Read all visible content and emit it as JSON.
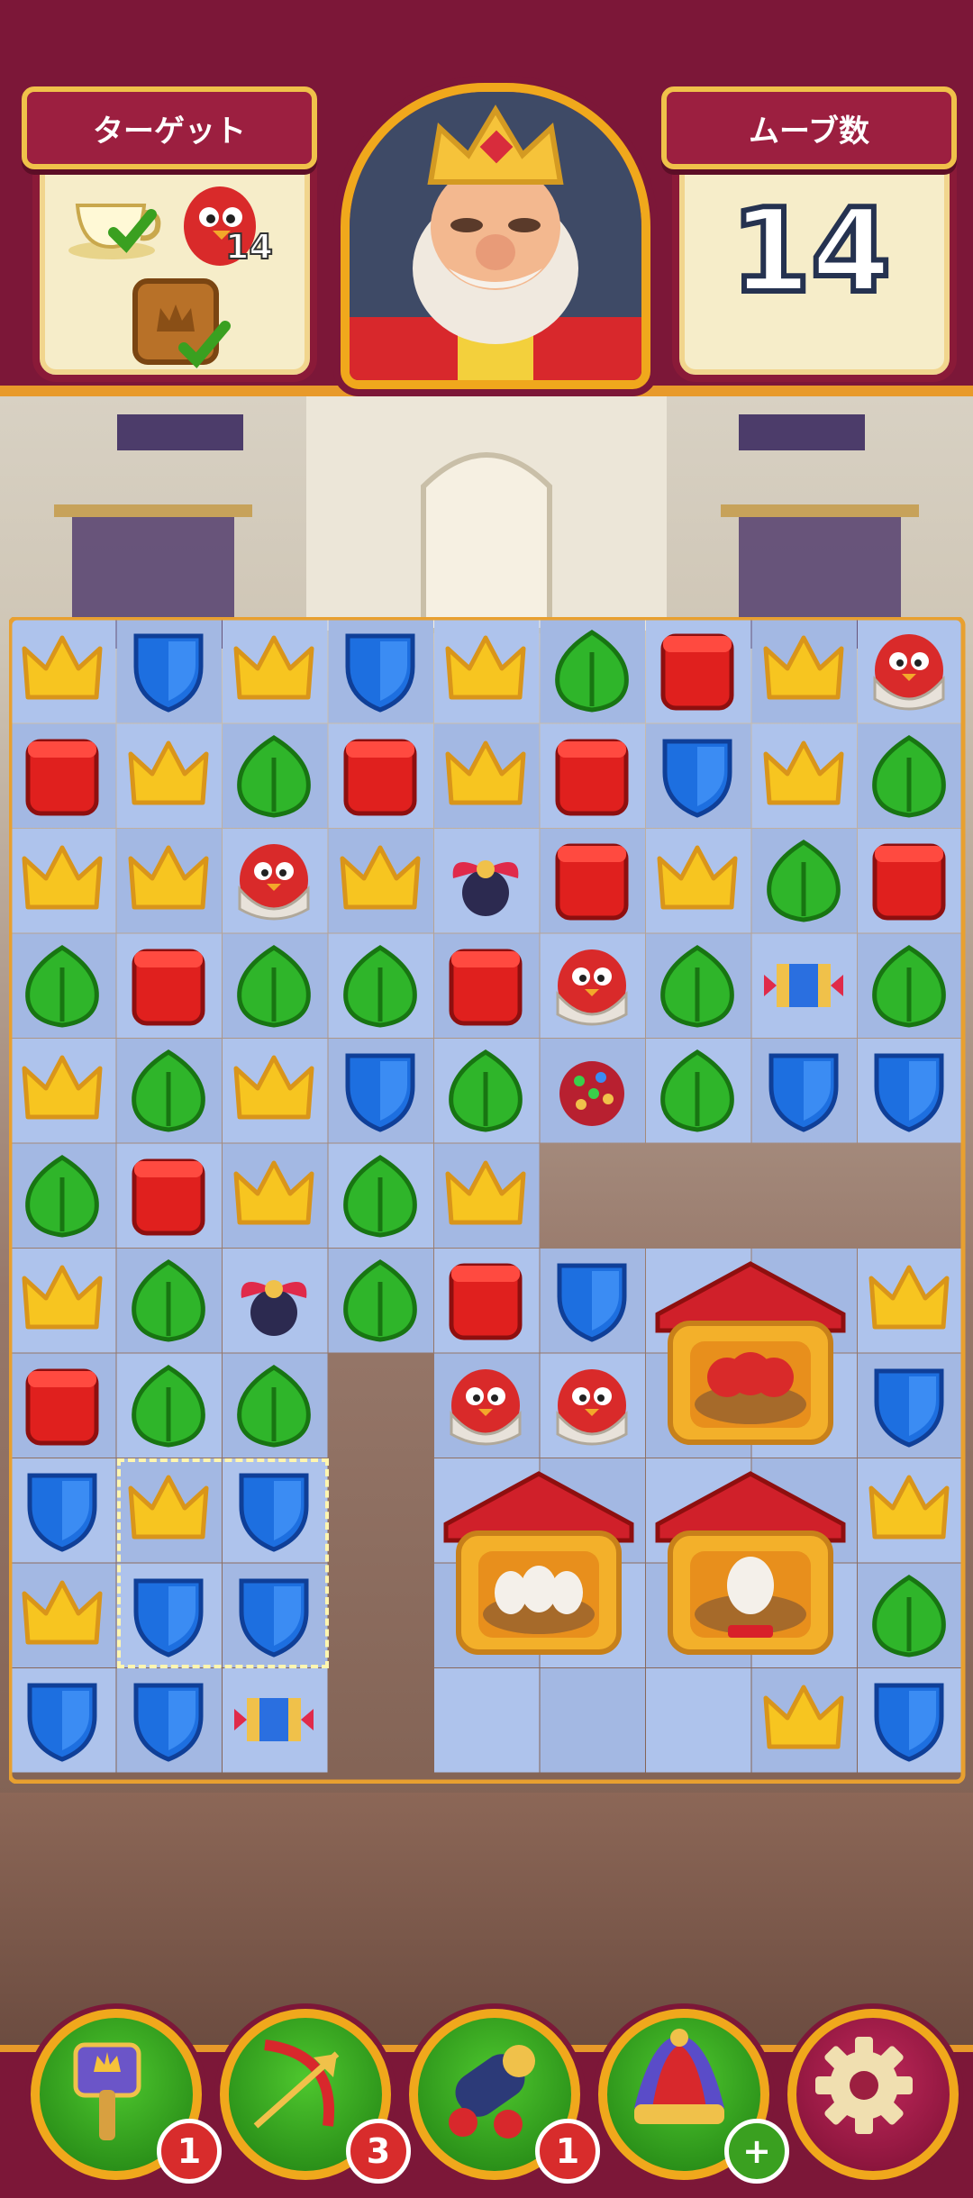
{
  "header": {
    "target_label": "ターゲット",
    "moves_label": "ムーブ数",
    "moves_left": "14",
    "targets": [
      {
        "icon": "teacup-icon",
        "done": true
      },
      {
        "icon": "red-bird-icon",
        "count": "14"
      },
      {
        "icon": "crown-box-icon",
        "done": true
      }
    ]
  },
  "board": {
    "cols": 9,
    "rows": 11,
    "grid": [
      [
        "crown",
        "shield",
        "crown",
        "shield",
        "crown",
        "leaf",
        "box",
        "crown",
        "bird"
      ],
      [
        "box",
        "crown",
        "leaf",
        "box",
        "crown",
        "box",
        "shield",
        "crown",
        "leaf"
      ],
      [
        "crown",
        "crown",
        "bird",
        "crown",
        "propeller",
        "box",
        "crown",
        "leaf",
        "box"
      ],
      [
        "leaf",
        "box",
        "leaf",
        "leaf",
        "box",
        "bird",
        "leaf",
        "rocket",
        "leaf"
      ],
      [
        "crown",
        "leaf",
        "crown",
        "shield",
        "leaf",
        "bomb",
        "leaf",
        "shield",
        "shield"
      ],
      [
        "leaf",
        "box",
        "crown",
        "leaf",
        "crown",
        "hole",
        "hole",
        "hole",
        "hole"
      ],
      [
        "crown",
        "leaf",
        "propeller",
        "leaf",
        "box",
        "shield",
        "nest",
        "",
        "crown"
      ],
      [
        "box",
        "leaf",
        "leaf",
        "hole",
        "bird",
        "bird",
        "",
        "",
        "shield"
      ],
      [
        "shield",
        "crown",
        "shield",
        "hole",
        "nest",
        "",
        "nest",
        "",
        "crown"
      ],
      [
        "crown",
        "shield",
        "shield",
        "hole",
        "",
        "",
        "",
        "",
        "leaf"
      ],
      [
        "shield",
        "shield",
        "rocket",
        "hole",
        "empty",
        "empty",
        "empty",
        "crown",
        "shield"
      ]
    ],
    "nest_labels": [
      "bird-nest",
      "egg-nest",
      "single-egg-nest"
    ]
  },
  "boosters": [
    {
      "name": "hammer",
      "count": "1"
    },
    {
      "name": "arrow",
      "count": "3"
    },
    {
      "name": "cannon",
      "count": "1"
    },
    {
      "name": "jester",
      "count": "+"
    }
  ],
  "colors": {
    "header_bg": "#7c1738",
    "accent": "#f0a81c",
    "cell_bg": "#a9bfe8"
  }
}
